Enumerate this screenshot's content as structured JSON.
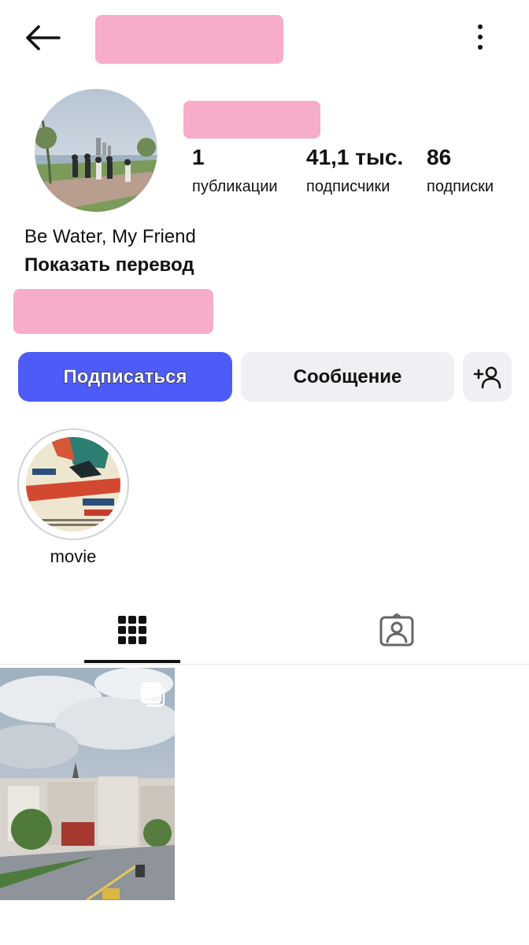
{
  "profile": {
    "bio": "Be Water, My Friend",
    "show_translation": "Показать перевод"
  },
  "stats": {
    "posts": {
      "value": "1",
      "label": "публикации"
    },
    "followers": {
      "value": "41,1 тыс.",
      "label": "подписчики"
    },
    "following": {
      "value": "86",
      "label": "подписки"
    }
  },
  "actions": {
    "follow_label": "Подписаться",
    "message_label": "Сообщение",
    "add_user_icon": "person-add-icon"
  },
  "highlights": [
    {
      "label": "movie"
    }
  ],
  "tabs": {
    "grid_icon": "grid-icon",
    "tagged_icon": "tagged-person-icon",
    "active": "grid"
  },
  "colors": {
    "follow_button": "#4d5cf6",
    "secondary_button": "#eef0f3",
    "redaction": "#f7adc9"
  },
  "icons": {
    "back": "arrow-left-icon",
    "more": "more-vertical-icon",
    "carousel": "multiple-photos-icon"
  }
}
